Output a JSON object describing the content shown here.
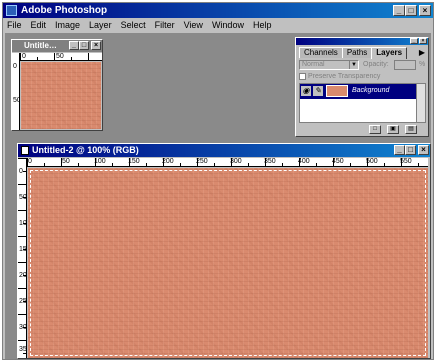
{
  "app": {
    "title": "Adobe Photoshop",
    "window_buttons": {
      "minimize": "_",
      "maximize": "□",
      "close": "×"
    }
  },
  "menu": [
    "File",
    "Edit",
    "Image",
    "Layer",
    "Select",
    "Filter",
    "View",
    "Window",
    "Help"
  ],
  "doc_small": {
    "title": "Untitle…",
    "ruler_h": [
      "0",
      "50"
    ],
    "ruler_v": [
      "0",
      "50"
    ]
  },
  "layers_palette": {
    "tabs": [
      "Channels",
      "Paths",
      "Layers"
    ],
    "active_tab": "Layers",
    "blend_mode": "Normal",
    "opacity_label": "Opacity:",
    "opacity_value": "",
    "percent": "%",
    "preserve_transparency": "Preserve Transparency",
    "layers": [
      {
        "name": "Background",
        "visible": true,
        "selected": true
      }
    ],
    "menu_arrow": "▶"
  },
  "doc_main": {
    "title": "Untitled-2 @ 100% (RGB)",
    "ruler_h": [
      "0",
      "50",
      "100",
      "150",
      "200",
      "250",
      "300",
      "350",
      "400",
      "450",
      "500",
      "550"
    ],
    "ruler_v": [
      "0",
      "50",
      "100",
      "150",
      "200",
      "250",
      "300",
      "350"
    ]
  },
  "colors": {
    "title_active": "#000080",
    "title_inactive": "#808080",
    "canvas_fill": "#d98a6e",
    "chrome": "#c0c0c0",
    "workspace": "#8a8a8a"
  },
  "icons": [
    "photoshop-app-icon",
    "eye-icon",
    "paintbrush-icon",
    "document-icon"
  ]
}
